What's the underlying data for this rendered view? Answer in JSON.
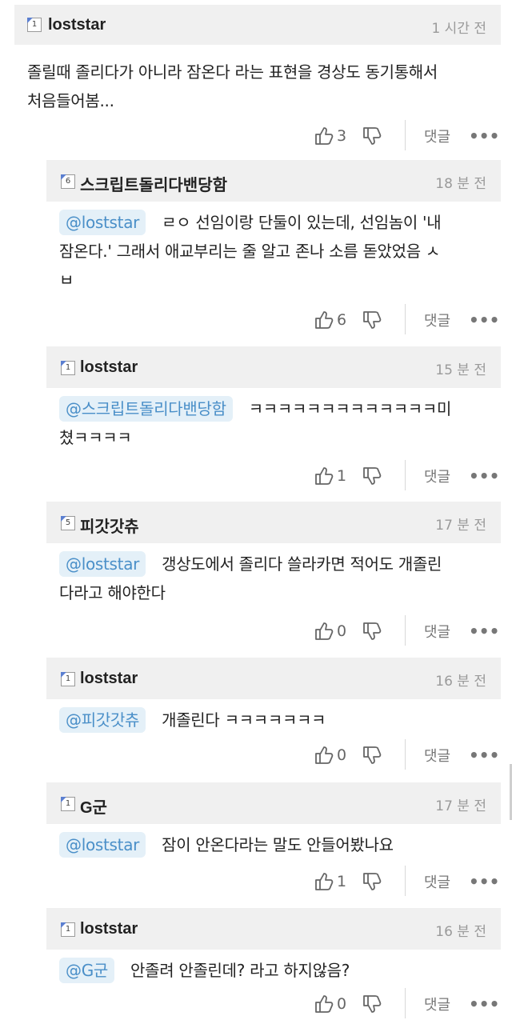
{
  "comments": [
    {
      "level": "1",
      "username": "loststar",
      "time": "1 시간 전",
      "mention": "",
      "lines": [
        "졸릴때 졸리다가 아니라 잠온다 라는 표현을 경상도 동기통해서",
        "처음들어봄..."
      ],
      "likes": "3",
      "reply_label": "댓글",
      "more_label": "•••"
    },
    {
      "level": "6",
      "username": "스크립트돌리다밴당함",
      "time": "18 분 전",
      "mention": "@loststar",
      "lines": [
        "ㄹㅇ 선임이랑 단둘이 있는데, 선임놈이 '내",
        "잠온다.' 그래서 애교부리는 줄 알고 존나 소름 돋았었음 ㅅ",
        "ㅂ"
      ],
      "likes": "6",
      "reply_label": "댓글",
      "more_label": "•••"
    },
    {
      "level": "1",
      "username": "loststar",
      "time": "15 분 전",
      "mention": "@스크립트돌리다밴당함",
      "lines": [
        "ㅋㅋㅋㅋㅋㅋㅋㅋㅋㅋㅋㅋㅋ미",
        "쳤ㅋㅋㅋㅋ"
      ],
      "likes": "1",
      "reply_label": "댓글",
      "more_label": "•••"
    },
    {
      "level": "5",
      "username": "피갓갓츄",
      "time": "17 분 전",
      "mention": "@loststar",
      "lines": [
        "갱상도에서 졸리다 쓸라카면 적어도 개졸린",
        "다라고 해야한다"
      ],
      "likes": "0",
      "reply_label": "댓글",
      "more_label": "•••"
    },
    {
      "level": "1",
      "username": "loststar",
      "time": "16 분 전",
      "mention": "@피갓갓츄",
      "lines": [
        "개졸린다 ㅋㅋㅋㅋㅋㅋㅋ"
      ],
      "likes": "0",
      "reply_label": "댓글",
      "more_label": "•••"
    },
    {
      "level": "1",
      "username": "G군",
      "time": "17 분 전",
      "mention": "@loststar",
      "lines": [
        "잠이 안온다라는 말도 안들어봤나요"
      ],
      "likes": "1",
      "reply_label": "댓글",
      "more_label": "•••"
    },
    {
      "level": "1",
      "username": "loststar",
      "time": "16 분 전",
      "mention": "@G군",
      "lines": [
        "안졸려 안졸린데? 라고 하지않음?"
      ],
      "likes": "0",
      "reply_label": "댓글",
      "more_label": "•••"
    }
  ]
}
